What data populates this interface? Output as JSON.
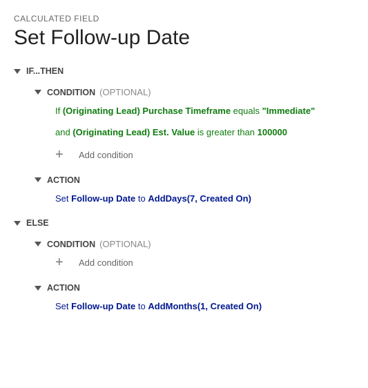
{
  "eyebrow": "CALCULATED FIELD",
  "title": "Set Follow-up Date",
  "ifthen": {
    "label": "IF...THEN",
    "condition": {
      "label": "CONDITION",
      "optional": "(OPTIONAL)",
      "line1": {
        "prefix": "If ",
        "field": "(Originating Lead) Purchase Timeframe",
        "op": " equals ",
        "value": "\"Immediate\""
      },
      "line2": {
        "prefix": "and ",
        "field": "(Originating Lead) Est. Value",
        "op": " is greater than ",
        "value": "100000"
      },
      "add": "Add condition"
    },
    "action": {
      "label": "ACTION",
      "set": "Set ",
      "field": "Follow-up Date",
      "to": " to ",
      "func": "AddDays(7, Created On)"
    }
  },
  "else": {
    "label": "ELSE",
    "condition": {
      "label": "CONDITION",
      "optional": "(OPTIONAL)",
      "add": "Add condition"
    },
    "action": {
      "label": "ACTION",
      "set": "Set ",
      "field": "Follow-up Date",
      "to": " to ",
      "func": "AddMonths(1, Created On)"
    }
  }
}
